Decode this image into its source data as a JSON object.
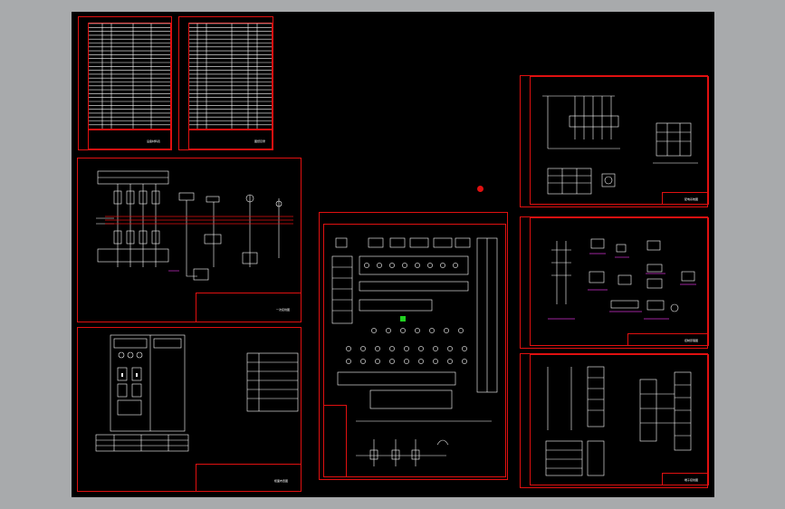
{
  "viewer": {
    "background": "#a8aaac",
    "canvas_color": "#000000",
    "frame_color": "#e01010",
    "line_color": "#ffffff"
  },
  "sheets": [
    {
      "id": "table-sheet-1",
      "titleblock_text": "设备材料表"
    },
    {
      "id": "table-sheet-2",
      "titleblock_text": "图纸目录"
    },
    {
      "id": "primary-wiring-sheet",
      "titleblock_text": "一次接线图"
    },
    {
      "id": "panel-layout-sheet",
      "titleblock_text": "柜面布置图"
    },
    {
      "id": "main-schematic-sheet",
      "titleblock_text": ""
    },
    {
      "id": "distribution-sheet",
      "titleblock_text": "配电系统图"
    },
    {
      "id": "control-circuit-sheet",
      "titleblock_text": "控制原理图"
    },
    {
      "id": "terminal-sheet",
      "titleblock_text": "端子接线图"
    }
  ],
  "markers": {
    "cursor_color": "#e01010",
    "selection_color": "#20d020"
  }
}
